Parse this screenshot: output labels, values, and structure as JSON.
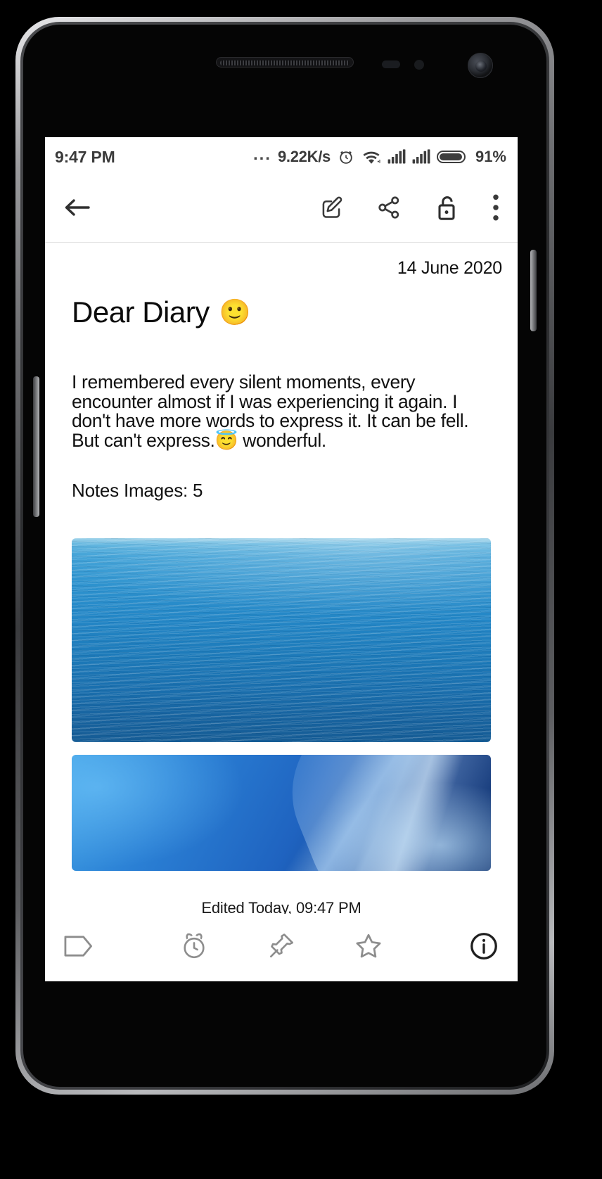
{
  "device": {
    "kind": "android-phone-mockup",
    "hardware": [
      "earpiece-speaker",
      "proximity-sensor",
      "light-sensor",
      "front-camera",
      "power-button",
      "volume-button"
    ]
  },
  "status_bar": {
    "time": "9:47 PM",
    "dots": "...",
    "network_speed": "9.22K/s",
    "icons": [
      "alarm-clock-icon",
      "wifi-icon",
      "signal-sim1-icon",
      "signal-sim2-icon",
      "battery-icon"
    ],
    "battery_percent": "91%"
  },
  "toolbar": {
    "back_label": "back-arrow",
    "actions": [
      {
        "name": "edit",
        "icon": "edit-square-pencil-icon"
      },
      {
        "name": "share",
        "icon": "share-nodes-icon"
      },
      {
        "name": "lock",
        "icon": "unlock-padlock-icon"
      },
      {
        "name": "more",
        "icon": "overflow-menu-icon"
      }
    ]
  },
  "note": {
    "date": "14 June 2020",
    "title": "Dear Diary",
    "title_emoji": "🙂",
    "body_lines": [
      "I remembered every silent moments, every",
      "encounter almost if I was experiencing it again. I",
      "don't have more words to express it. It can be fell.",
      "But can't express.😇 wonderful."
    ],
    "body_text": "I remembered every silent moments, every encounter almost if I was experiencing it again. I don't have more words to express it. It can be fell. But can't express.😇 wonderful.",
    "images_count_label": "Notes Images: 5",
    "images": [
      {
        "name": "ocean-water-photo",
        "alt": "Blue ocean water surface"
      },
      {
        "name": "blue-abstract-wallpaper",
        "alt": "Blue abstract gradient wallpaper"
      }
    ],
    "edited": "Edited Today, 09:47 PM"
  },
  "bottom_bar": {
    "items": [
      {
        "name": "tag",
        "icon": "tag-label-icon"
      },
      {
        "name": "reminder",
        "icon": "alarm-clock-icon"
      },
      {
        "name": "pin",
        "icon": "pushpin-icon"
      },
      {
        "name": "favorite",
        "icon": "star-outline-icon"
      },
      {
        "name": "info",
        "icon": "info-circle-icon"
      }
    ]
  },
  "colors": {
    "accent_blue": "#2386c6",
    "toolbar_icon": "#3a3a3a",
    "bottom_icon": "#8a8a8a",
    "text": "#111111",
    "screen_bg": "#ffffff"
  }
}
